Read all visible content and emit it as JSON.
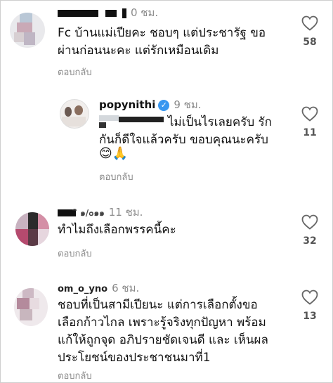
{
  "comments": [
    {
      "time": "0 ชม.",
      "text": "Fc บ้านแม่เปียคะ ชอบๆ แต่ประชารัฐ ขอ\nผ่านก่อนนะคะ  แต่รักเหมือนเดิม",
      "reply_label": "ตอบกลับ",
      "likes": "58"
    },
    {
      "username": "popynithi",
      "time": "9 ชม.",
      "text": "ไม่เป็นไรเลยครับ รัก\nกันก็ดีใจแล้วครับ ขอบคุณนะครับ",
      "emojis": "😊🙏",
      "reply_label": "ตอบกลับ",
      "likes": "11"
    },
    {
      "username_partial": "ิ ๑/๐๑๑",
      "time": "11 ชม.",
      "text": "ทำไมถึงเลือกพรรคนี้คะ",
      "reply_label": "ตอบกลับ",
      "likes": "32"
    },
    {
      "username_partial": "om_o_yno",
      "time": "6 ชม.",
      "text": "ชอบที่เป็นสามีเปียนะ  แต่การเลือกตั้งขอ\nเลือกก้าวไกล  เพราะรู้จริงทุกปัญหา พร้อม\nแก้ให้ถูกจุด อภิปรายชัดเจนดี และ เห็นผล\nประโยชน์ของประชาชนมาที่1",
      "reply_label": "ตอบกลับ",
      "likes": "13"
    }
  ],
  "colors": {
    "muted": "#8a8a8a",
    "verified": "#3897f0"
  }
}
